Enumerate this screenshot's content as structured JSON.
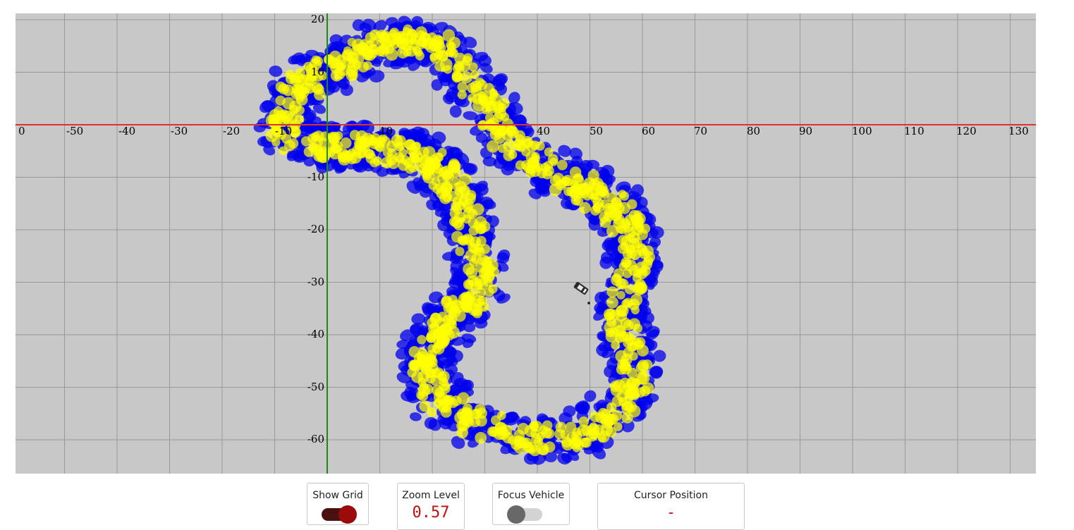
{
  "map": {
    "x_ticks": [
      "0",
      "-50",
      "-40",
      "-30",
      "-20",
      "-10",
      "10",
      "40",
      "50",
      "60",
      "70",
      "80",
      "90",
      "100",
      "110",
      "120",
      "130"
    ],
    "y_ticks": [
      "20",
      "10",
      "-10",
      "-20",
      "-30",
      "-40",
      "-50",
      "-60"
    ],
    "x_axis_color": "#e03030",
    "y_axis_color": "#1a8a1a",
    "grid_color": "#999999",
    "background_color": "#c8c8c8",
    "particle_colors": {
      "outer": "#0000ee",
      "inner": "#ffff00"
    },
    "vehicle_icon": "car-icon"
  },
  "controls": {
    "show_grid": {
      "label": "Show Grid",
      "state": "on"
    },
    "zoom_level": {
      "label": "Zoom Level",
      "value": "0.57"
    },
    "focus_vehicle": {
      "label": "Focus Vehicle",
      "state": "off"
    },
    "cursor_position": {
      "label": "Cursor Position",
      "value": "-"
    },
    "value_color": "#c01010"
  }
}
